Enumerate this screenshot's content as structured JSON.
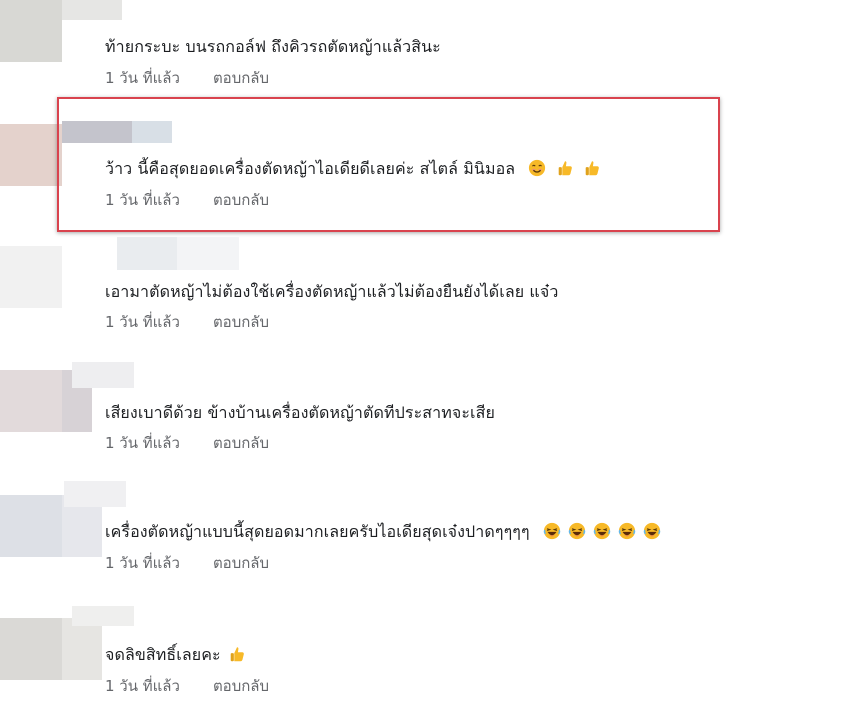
{
  "comments": [
    {
      "text": "ท้ายกระบะ บนรถกอล์ฟ ถึงคิวรถตัดหญ้าแล้วสินะ",
      "time": "1 วัน ที่แล้ว",
      "reply": "ตอบกลับ",
      "emojis": []
    },
    {
      "text": "ว้าว นี้คือสุดยอดเครื่องตัดหญ้าไอเดียดีเลยค่ะ สไตล์ มินิมอล",
      "time": "1 วัน ที่แล้ว",
      "reply": "ตอบกลับ",
      "emojis": [
        "smiling-face-icon",
        "thumbs-up-icon",
        "thumbs-up-icon"
      ]
    },
    {
      "text": "เอามาตัดหญ้าไม่ต้องใช้เครื่องตัดหญ้าแล้วไม่ต้องยืนยังได้เลย แจ๋ว",
      "time": "1 วัน ที่แล้ว",
      "reply": "ตอบกลับ",
      "emojis": []
    },
    {
      "text": "เสียงเบาดีด้วย ข้างบ้านเครื่องตัดหญ้าตัดทีประสาทจะเสีย",
      "time": "1 วัน ที่แล้ว",
      "reply": "ตอบกลับ",
      "emojis": []
    },
    {
      "text": "เครื่องตัดหญ้าแบบนี้สุดยอดมากเลยครับไอเดียสุดเจ๋งปาดๆๆๆๆ",
      "time": "1 วัน ที่แล้ว",
      "reply": "ตอบกลับ",
      "emojis": [
        "laughing-face-icon",
        "laughing-face-icon",
        "laughing-face-icon",
        "laughing-face-icon",
        "laughing-face-icon"
      ]
    },
    {
      "text": "จดลิขสิทธิ์เลยคะ",
      "time": "1 วัน ที่แล้ว",
      "reply": "ตอบกลับ",
      "emojis": [
        "thumbs-up-icon"
      ]
    }
  ],
  "colors": {
    "text": "#1c1e21",
    "meta": "#65676b",
    "highlight_border": "#d9434e",
    "emoji_yellow": "#f7b928"
  }
}
